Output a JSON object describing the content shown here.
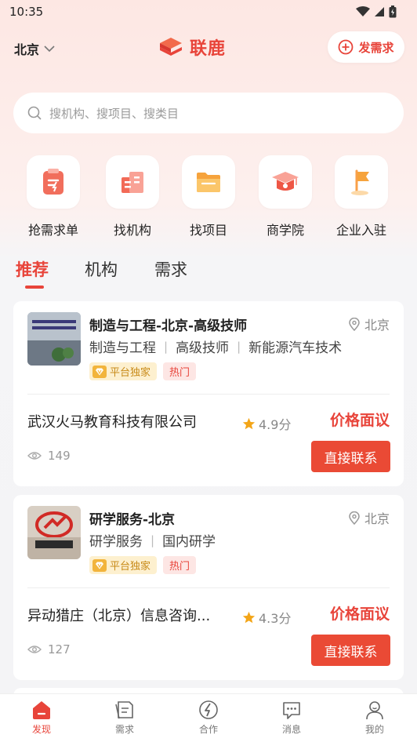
{
  "status_bar": {
    "time": "10:35"
  },
  "header": {
    "city": "北京",
    "brand": "联鹿",
    "publish_label": "发需求"
  },
  "search": {
    "placeholder": "搜机构、搜项目、搜类目"
  },
  "quick_entries": [
    {
      "label": "抢需求单",
      "icon": "clipboard-icon"
    },
    {
      "label": "找机构",
      "icon": "building-icon"
    },
    {
      "label": "找项目",
      "icon": "folder-icon"
    },
    {
      "label": "商学院",
      "icon": "graduation-cap-icon"
    },
    {
      "label": "企业入驻",
      "icon": "flag-icon"
    }
  ],
  "tabs": [
    {
      "label": "推荐",
      "active": true
    },
    {
      "label": "机构",
      "active": false
    },
    {
      "label": "需求",
      "active": false
    }
  ],
  "cards": [
    {
      "title": "制造与工程-北京-高级技师",
      "location": "北京",
      "tags": [
        "制造与工程",
        "高级技师",
        "新能源汽车技术"
      ],
      "badge_exclusive": "平台独家",
      "badge_hot": "热门",
      "company": "武汉火马教育科技有限公司",
      "rating": "4.9分",
      "price": "价格面议",
      "views": "149",
      "contact_label": "直接联系",
      "thumb_text": "火马教育 武汉火马教育科技有限公司"
    },
    {
      "title": "研学服务-北京",
      "location": "北京",
      "tags": [
        "研学服务",
        "国内研学"
      ],
      "badge_exclusive": "平台独家",
      "badge_hot": "热门",
      "company": "异动猎庄（北京）信息咨询...",
      "rating": "4.3分",
      "price": "价格面议",
      "views": "127",
      "contact_label": "直接联系",
      "thumb_text": "异动猎庄"
    }
  ],
  "bottom_nav": [
    {
      "label": "发现",
      "icon": "home-icon",
      "active": true
    },
    {
      "label": "需求",
      "icon": "document-icon",
      "active": false
    },
    {
      "label": "合作",
      "icon": "cooperation-icon",
      "active": false
    },
    {
      "label": "消息",
      "icon": "message-icon",
      "active": false
    },
    {
      "label": "我的",
      "icon": "user-icon",
      "active": false
    }
  ],
  "colors": {
    "accent": "#e8443a",
    "gold": "#c88a18"
  }
}
